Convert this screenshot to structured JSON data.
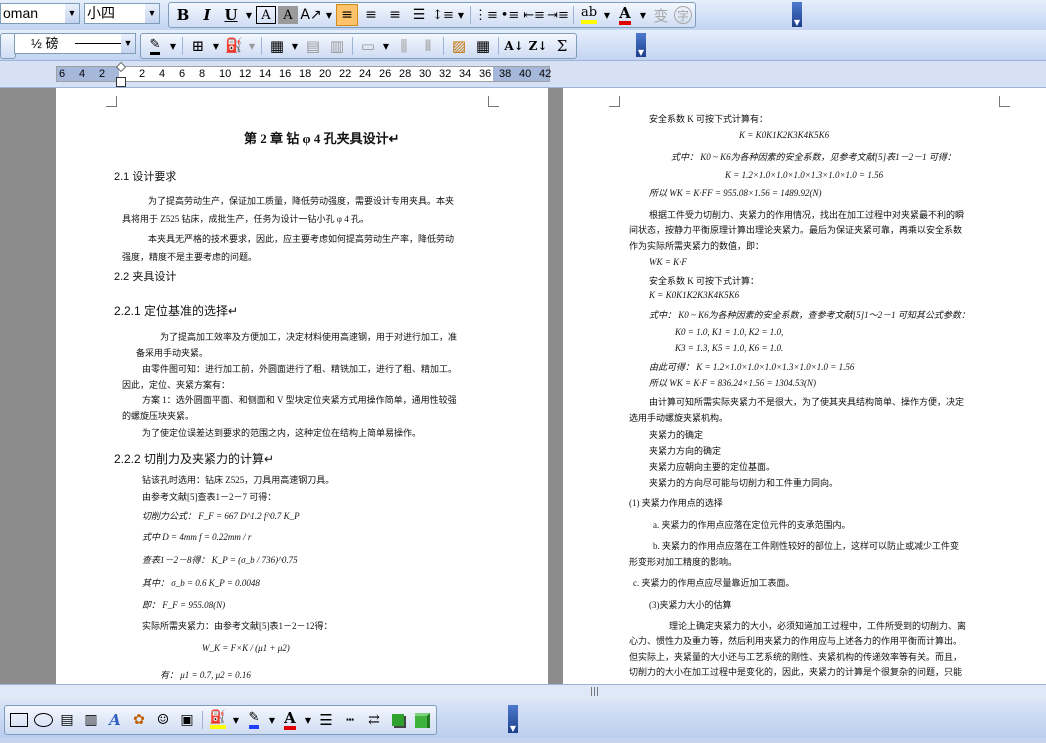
{
  "toolbar_format": {
    "font_name": "oman",
    "font_size": "小四",
    "bold_label": "B",
    "italic_label": "I",
    "underline_label": "U",
    "border_a": "A",
    "shading_a": "A",
    "font_color_a": "A",
    "phonetic": "变",
    "enclosed": "字"
  },
  "toolbar_table": {
    "line_weight": "½ 磅",
    "sum_label": "Σ"
  },
  "ruler": {
    "ticks": [
      "6",
      "4",
      "2",
      "2",
      "4",
      "6",
      "8",
      "10",
      "12",
      "14",
      "16",
      "18",
      "20",
      "22",
      "24",
      "26",
      "28",
      "30",
      "32",
      "34",
      "36",
      "38",
      "40",
      "42"
    ]
  },
  "page1": {
    "chapter_title": "第 2 章  钻 φ 4 孔夹具设计↵",
    "s21": "2.1 设计要求",
    "p1a": "为了提高劳动生产，保证加工质量，降低劳动强度，需要设计专用夹具。本夹",
    "p1b": "具将用于 Z525 钻床，成批生产，任务为设计一钻小孔 φ 4 孔。",
    "p2a": "本夹具无严格的技术要求，因此，应主要考虑如何提高劳动生产率，降低劳动",
    "p2b": "强度，精度不是主要考虑的问题。",
    "s22": "2.2 夹具设计",
    "s221": "2.2.1    定位基准的选择↵",
    "p3a": "为了提高加工效率及方便加工，决定材料使用高速钢，用于对进行加工，准",
    "p3b": "备采用手动夹紧。",
    "p4a": "由零件图可知：进行加工前，外圆面进行了粗、精铣加工，进行了粗、精加工。",
    "p4b": "因此，定位、夹紧方案有：",
    "p5a": "方案 1：选外圆面平面、和侧面和 V 型块定位夹紧方式用操作简单，通用性较强",
    "p5b": "的螺旋压块夹紧。",
    "p6": "为了使定位误差达到要求的范围之内，这种定位在结构上简单易操作。",
    "s222": "2.2.2    切削力及夹紧力的计算↵",
    "p7": "钻该孔时选用：钻床 Z525，刀具用高速钢刀具。",
    "p8": "由参考文献[5]查表1－2－7 可得：",
    "f1": "切削力公式：  F_F = 667 D^1.2 f^0.7 K_P",
    "f2": "式中   D = 4mm     f = 0.22mm / r",
    "f3": "查表1－2－8得：  K_P = (σ_b / 736)^0.75",
    "f4": "其中：  σ_b = 0.6               K_P = 0.0048",
    "f5": "即：  F_F = 955.08(N)",
    "p9": "实际所需夹紧力：由参考文献[5]表1－2－12得：",
    "f6": "W_K = F×K / (μ1 + μ2)",
    "f7": "有：  μ1 = 0.7, μ2 = 0.16"
  },
  "page2": {
    "l1": "安全系数 K 可按下式计算有：",
    "l2": "K = K0K1K2K3K4K5K6",
    "l3": "式中：  K0 ~ K6为各种因素的安全系数，见参考文献[5]表1－2－1   可得：",
    "l4": "K = 1.2×1.0×1.0×1.0×1.3×1.0×1.0 = 1.56",
    "l5": "所以     WK = K·FF = 955.08×1.56 = 1489.92(N)",
    "l6": "根据工件受力切削力、夹紧力的作用情况，找出在加工过程中对夹紧最不利的瞬",
    "l7": "间状态，按静力平衡原理计算出理论夹紧力。最后为保证夹紧可靠，再乘以安全系数",
    "l8": "作为实际所需夹紧力的数值，即：",
    "l9": "WK = K·F",
    "l10": "安全系数 K 可按下式计算：",
    "l11": "K = K0K1K2K3K4K5K6",
    "l12": "式中：  K0 ~ K6为各种因素的安全系数，查参考文献[5]1～2－1 可知其公式参数：",
    "l13": "K0 = 1.0, K1 = 1.0, K2 = 1.0,",
    "l14": "K3 = 1.3, K5 = 1.0, K6 = 1.0.",
    "l15": "由此可得：       K = 1.2×1.0×1.0×1.0×1.3×1.0×1.0 = 1.56",
    "l16": "所以     WK = K·F = 836.24×1.56 = 1304.53(N)",
    "l17": "由计算可知所需实际夹紧力不是很大，为了使其夹具结构简单、操作方便，决定",
    "l18": "选用手动螺旋夹紧机构。",
    "l19": "夹紧力的确定",
    "l20": "夹紧力方向的确定",
    "l21": "夹紧力应朝向主要的定位基面。",
    "l22": "夹紧力的方向尽可能与切削力和工件重力同向。",
    "l23": "(1)     夹紧力作用点的选择",
    "l24": "a.  夹紧力的作用点应落在定位元件的支承范围内。",
    "l25": "b.  夹紧力的作用点应落在工件刚性较好的部位上，这样可以防止或减少工件变",
    "l26": "形变形对加工精度的影响。",
    "l27": "c.  夹紧力的作用点应尽量靠近加工表面。",
    "l28": "(3)夹紧力大小的估算",
    "l29": "理论上确定夹紧力的大小，必须知道加工过程中，工件所受到的切削力、离",
    "l30": "心力、惯性力及重力等，然后利用夹紧力的作用应与上述各力的作用平衡而计算出。",
    "l31": "但实际上，夹紧量的大小还与工艺系统的刚性、夹紧机构的传递效率等有关。而且，",
    "l32": "切削力的大小在加工过程中是变化的，因此，夹紧力的计算是个很复杂的问题，只能"
  },
  "colors": {
    "accent": "#ffc36b",
    "toolbar": "#c3d4f2",
    "doc_bg": "#8c8c8c"
  }
}
